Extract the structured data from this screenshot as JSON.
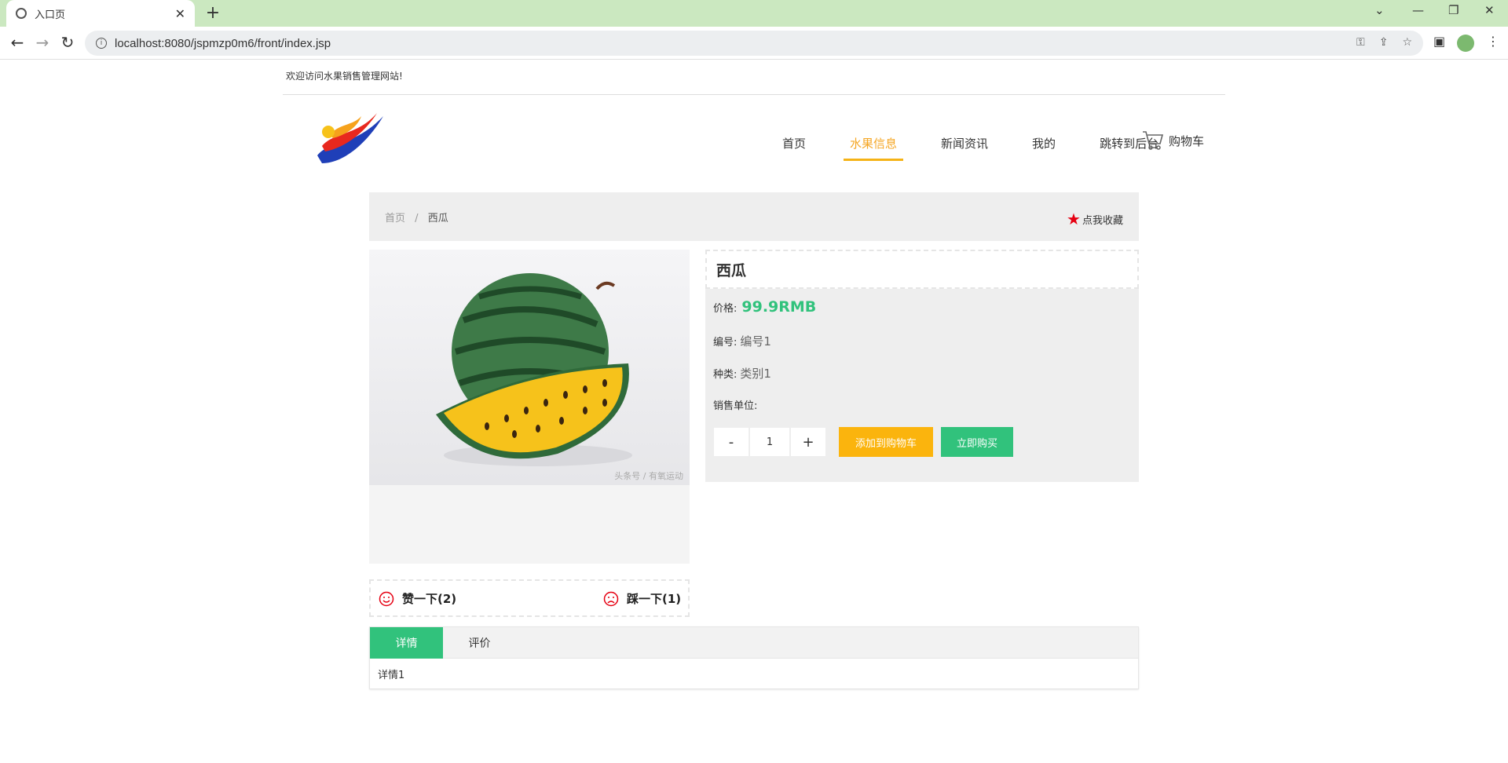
{
  "browser": {
    "tab_title": "入口页",
    "url": "localhost:8080/jspmzp0m6/front/index.jsp"
  },
  "header": {
    "welcome": "欢迎访问水果销售管理网站!",
    "nav": [
      {
        "label": "首页"
      },
      {
        "label": "水果信息"
      },
      {
        "label": "新闻资讯"
      },
      {
        "label": "我的"
      },
      {
        "label": "跳转到后台"
      }
    ],
    "cart_label": "购物车"
  },
  "breadcrumb": {
    "home": "首页",
    "separator": "/",
    "current": "西瓜",
    "favorite_label": "点我收藏"
  },
  "product": {
    "name": "西瓜",
    "price_label": "价格:",
    "price": "99.9RMB",
    "code_label": "编号:",
    "code": "编号1",
    "category_label": "种类:",
    "category": "类别1",
    "unit_label": "销售单位:",
    "unit": "",
    "quantity": "1",
    "minus": "-",
    "plus": "+",
    "add_to_cart": "添加到购物车",
    "buy_now": "立即购买",
    "image_watermark": "头条号 / 有氧运动"
  },
  "votes": {
    "like": "赞一下(2)",
    "dislike": "踩一下(1)"
  },
  "tabs": [
    {
      "label": "详情"
    },
    {
      "label": "评价"
    }
  ],
  "tab_content": "详情1",
  "colors": {
    "accent_green": "#31c27c",
    "accent_orange": "#fbb40d",
    "nav_active": "#f5a623"
  }
}
